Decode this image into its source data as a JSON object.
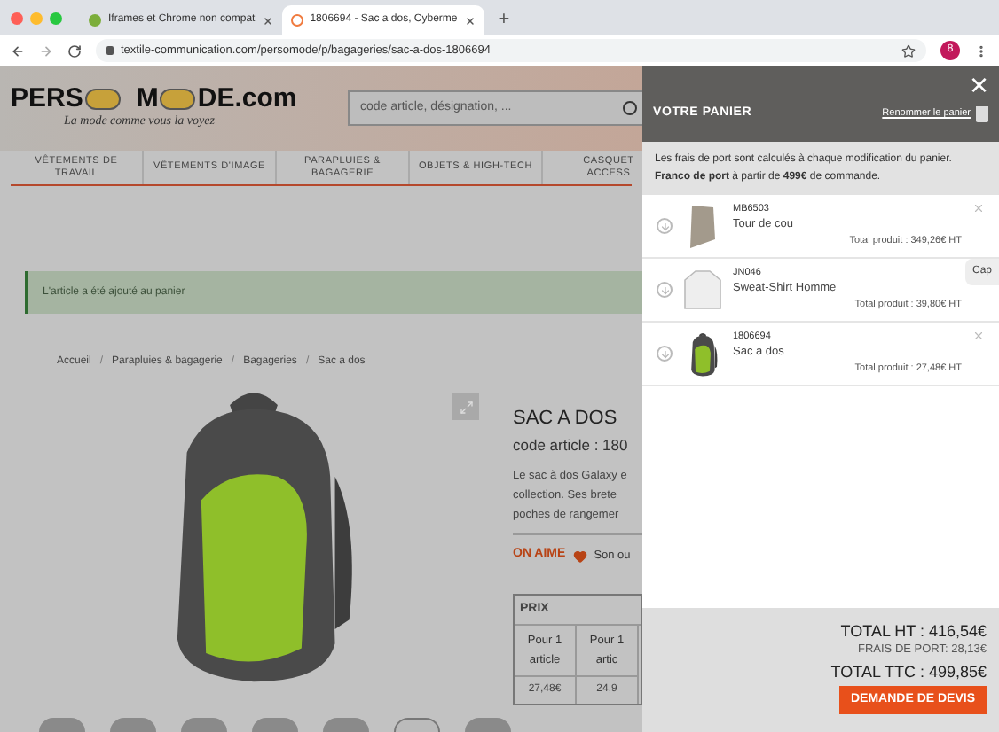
{
  "browser": {
    "tabs": [
      {
        "title": "Iframes et Chrome non compat",
        "selected": false
      },
      {
        "title": "1806694 - Sac a dos, Cyberme",
        "selected": true
      }
    ],
    "new_tab": "+",
    "url": "textile-communication.com/persomode/p/bagageries/sac-a-dos-1806694",
    "avatar": "8"
  },
  "header": {
    "logo": [
      "PERS",
      "M",
      "DE.com"
    ],
    "tagline": "La mode comme vous la voyez",
    "search": {
      "placeholder": "code article, désignation, ..."
    }
  },
  "nav": [
    [
      "VÊTEMENTS DE",
      "TRAVAIL"
    ],
    [
      "VÊTEMENTS D'IMAGE"
    ],
    [
      "PARAPLUIES &",
      "BAGAGERIE"
    ],
    [
      "OBJETS & HIGH-TECH"
    ],
    [
      "CASQUET",
      "ACCESS"
    ]
  ],
  "alert": "L'article a été ajouté au panier",
  "breadcrumb": [
    "Accueil",
    "Parapluies & bagagerie",
    "Bagageries",
    "Sac a dos"
  ],
  "breadcrumb_separator": "/",
  "product": {
    "title": "SAC A DOS",
    "code": "code article : 180",
    "description": [
      "Le sac à dos Galaxy e",
      "collection. Ses brete",
      "poches de rangemer"
    ],
    "on_aime": "ON AIME",
    "feature": "Son ou",
    "price_table": {
      "header": "PRIX",
      "columns": [
        [
          "Pour 1",
          "article"
        ],
        [
          "Pour 1",
          "artic"
        ]
      ],
      "prices": [
        "27,48€",
        "24,9"
      ]
    },
    "thumbnails": [
      {
        "selected": false
      },
      {
        "selected": false
      },
      {
        "selected": false
      },
      {
        "selected": false
      },
      {
        "selected": false
      },
      {
        "selected": true
      },
      {
        "selected": false
      }
    ]
  },
  "cart": {
    "close": "×",
    "title": "VOTRE PANIER",
    "rename": "Renommer le panier",
    "info": "Les frais de port sont calculés à chaque modification du panier.\n**Franco de port** à partir de **499€** de commande.",
    "items": [
      {
        "code": "MB6503",
        "name": "Tour de cou",
        "total": "Total produit : 349,26€ HT",
        "kind": "scarf"
      },
      {
        "code": "JN046",
        "name": "Sweat-Shirt Homme",
        "total": "Total produit : 39,80€ HT",
        "kind": "sweatshirt"
      },
      {
        "code": "1806694",
        "name": "Sac a dos",
        "total": "Total produit : 27,48€ HT",
        "kind": "backpack"
      }
    ],
    "side_tab": "Cap",
    "total_ht": "TOTAL HT : 416,54€",
    "shipping": "FRAIS DE PORT: 28,13€",
    "total_ttc": "TOTAL TTC : 499,85€",
    "button": "DEMANDE DE DEVIS"
  }
}
